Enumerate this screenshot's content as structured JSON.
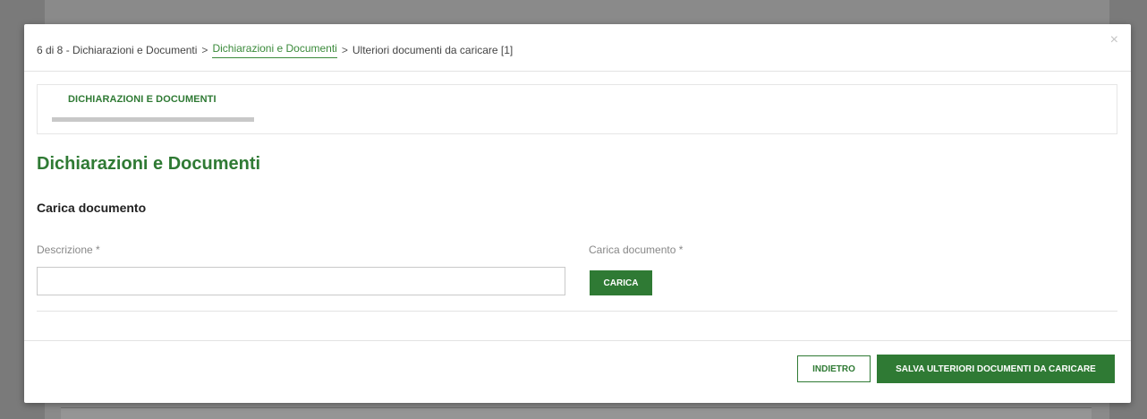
{
  "breadcrumb": {
    "step": "6 di 8 - Dichiarazioni e Documenti",
    "separator": ">",
    "link": "Dichiarazioni e Documenti",
    "current": "Ulteriori documenti da caricare [1]"
  },
  "modal": {
    "close_symbol": "×"
  },
  "tabs": [
    {
      "label": "DICHIARAZIONI E DOCUMENTI"
    }
  ],
  "page": {
    "title": "Dichiarazioni e Documenti",
    "section_title": "Carica documento"
  },
  "form": {
    "description_label": "Descrizione *",
    "description_value": "",
    "description_placeholder": "",
    "upload_label": "Carica documento *",
    "upload_button": "CARICA"
  },
  "footer": {
    "back_button": "INDIETRO",
    "save_button": "SALVA ULTERIORI DOCUMENTI DA CARICARE"
  },
  "colors": {
    "accent": "#2f7a34",
    "overlay": "#7a7a7a"
  }
}
